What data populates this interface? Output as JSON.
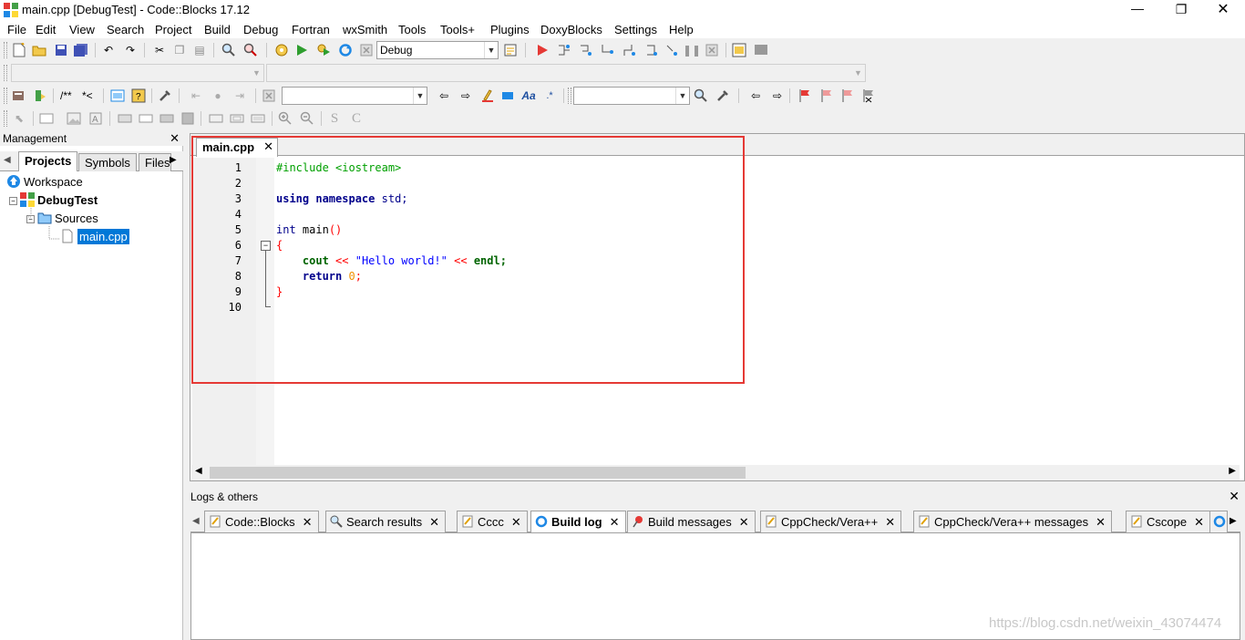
{
  "window": {
    "title": "main.cpp [DebugTest] - Code::Blocks 17.12",
    "minimize_glyph": "—",
    "maximize_glyph": "❐",
    "close_glyph": "✕"
  },
  "menu": [
    "File",
    "Edit",
    "View",
    "Search",
    "Project",
    "Build",
    "Debug",
    "Fortran",
    "wxSmith",
    "Tools",
    "Tools+",
    "Plugins",
    "DoxyBlocks",
    "Settings",
    "Help"
  ],
  "toolbar": {
    "build_target": "Debug",
    "doxy_comment_1": "/**",
    "doxy_comment_2": "*<"
  },
  "management": {
    "title": "Management",
    "close_glyph": "✕",
    "tabs": [
      "Projects",
      "Symbols",
      "Files"
    ],
    "tree": {
      "workspace": "Workspace",
      "project": "DebugTest",
      "folder": "Sources",
      "file": "main.cpp"
    }
  },
  "editor": {
    "tab_label": "main.cpp",
    "tab_close": "✕",
    "line_numbers": [
      "1",
      "2",
      "3",
      "4",
      "5",
      "6",
      "7",
      "8",
      "9",
      "10"
    ],
    "code": {
      "l1_pp": "#include <iostream>",
      "l3_using": "using",
      "l3_namespace": "namespace",
      "l3_std": "std;",
      "l5_int": "int",
      "l5_main": "main",
      "l5_parens": "()",
      "l6_brace": "{",
      "l7_cout": "cout",
      "l7_op1": "<<",
      "l7_str": "\"Hello world!\"",
      "l7_op2": "<<",
      "l7_endl": "endl;",
      "l8_return": "return",
      "l8_zero": "0",
      "l8_semi": ";",
      "l9_brace": "}"
    }
  },
  "logs": {
    "title": "Logs & others",
    "close_glyph": "✕",
    "tabs": [
      {
        "label": "Code::Blocks",
        "close": "✕"
      },
      {
        "label": "Search results",
        "close": "✕"
      },
      {
        "label": "Cccc",
        "close": "✕"
      },
      {
        "label": "Build log",
        "close": "✕"
      },
      {
        "label": "Build messages",
        "close": "✕"
      },
      {
        "label": "CppCheck/Vera++",
        "close": "✕"
      },
      {
        "label": "CppCheck/Vera++ messages",
        "close": "✕"
      },
      {
        "label": "Cscope",
        "close": "✕"
      }
    ],
    "active_tab": "Build log"
  },
  "watermark": "https://blog.csdn.net/weixin_43074474",
  "colors": {
    "highlight_box": "#e53935",
    "selection": "#0078d7"
  }
}
